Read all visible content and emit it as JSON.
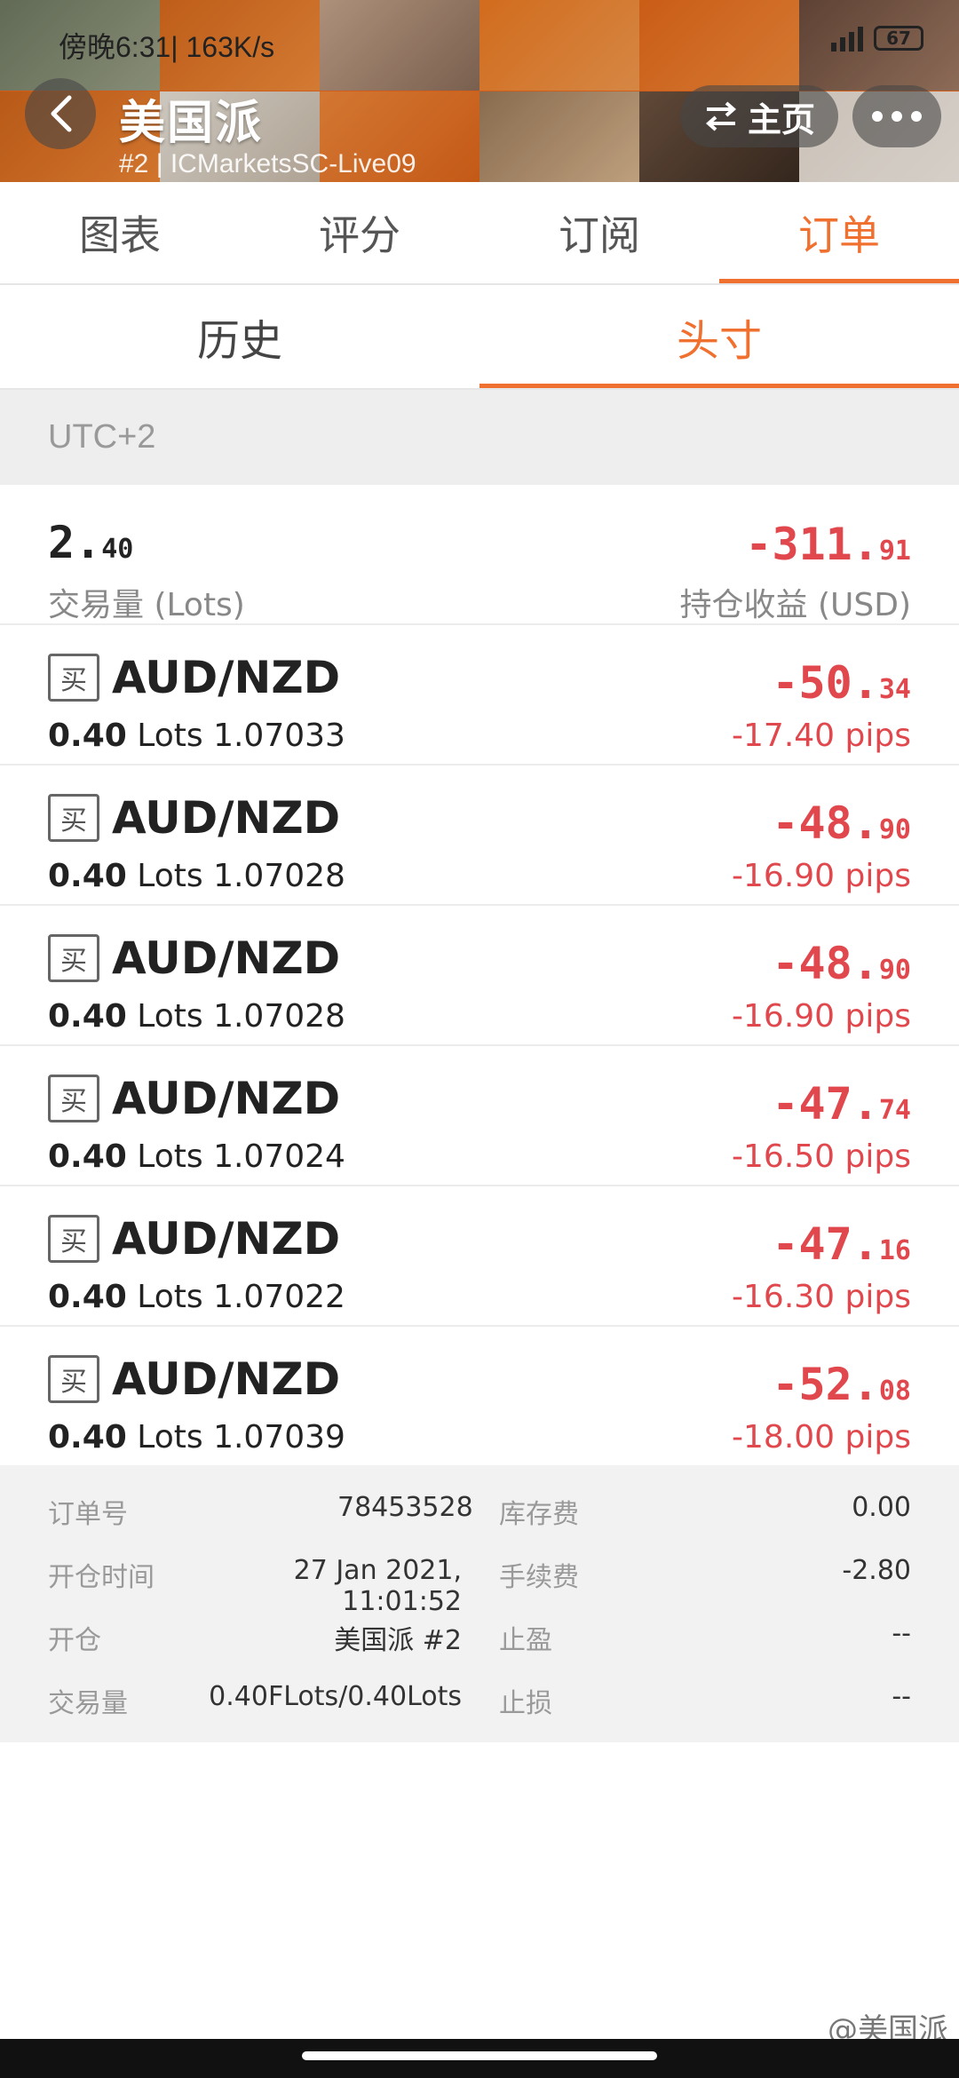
{
  "status_bar": {
    "time": "傍晚6:31",
    "speed": "163K/s",
    "battery": "67"
  },
  "header": {
    "title": "美国派",
    "subtitle": "#2 | ICMarketsSC-Live09",
    "home_label": "主页"
  },
  "main_tabs": [
    {
      "label": "图表",
      "active": false
    },
    {
      "label": "评分",
      "active": false
    },
    {
      "label": "订阅",
      "active": false
    },
    {
      "label": "订单",
      "active": true
    }
  ],
  "sub_tabs": [
    {
      "label": "历史",
      "active": false
    },
    {
      "label": "头寸",
      "active": true
    }
  ],
  "timezone": "UTC+2",
  "summary": {
    "volume_int": "2.",
    "volume_dec": "40",
    "volume_label": "交易量 (Lots)",
    "profit_int": "-311.",
    "profit_dec": "91",
    "profit_label": "持仓收益 (USD)"
  },
  "positions": [
    {
      "side": "买",
      "symbol": "AUD/NZD",
      "lots": "0.40",
      "lots_unit": "Lots",
      "price": "1.07033",
      "profit_int": "-50.",
      "profit_dec": "34",
      "pips": "-17.40 pips"
    },
    {
      "side": "买",
      "symbol": "AUD/NZD",
      "lots": "0.40",
      "lots_unit": "Lots",
      "price": "1.07028",
      "profit_int": "-48.",
      "profit_dec": "90",
      "pips": "-16.90 pips"
    },
    {
      "side": "买",
      "symbol": "AUD/NZD",
      "lots": "0.40",
      "lots_unit": "Lots",
      "price": "1.07028",
      "profit_int": "-48.",
      "profit_dec": "90",
      "pips": "-16.90 pips"
    },
    {
      "side": "买",
      "symbol": "AUD/NZD",
      "lots": "0.40",
      "lots_unit": "Lots",
      "price": "1.07024",
      "profit_int": "-47.",
      "profit_dec": "74",
      "pips": "-16.50 pips"
    },
    {
      "side": "买",
      "symbol": "AUD/NZD",
      "lots": "0.40",
      "lots_unit": "Lots",
      "price": "1.07022",
      "profit_int": "-47.",
      "profit_dec": "16",
      "pips": "-16.30 pips"
    },
    {
      "side": "买",
      "symbol": "AUD/NZD",
      "lots": "0.40",
      "lots_unit": "Lots",
      "price": "1.07039",
      "profit_int": "-52.",
      "profit_dec": "08",
      "pips": "-18.00 pips"
    }
  ],
  "detail": {
    "order_no_label": "订单号",
    "order_no": "78453528",
    "swap_label": "库存费",
    "swap": "0.00",
    "open_time_label": "开仓时间",
    "open_time": "27 Jan 2021, 11:01:52",
    "commission_label": "手续费",
    "commission": "-2.80",
    "open_label": "开仓",
    "open_by": "美国派 #2",
    "tp_label": "止盈",
    "tp": "--",
    "volume_label": "交易量",
    "volume": "0.40FLots/0.40Lots",
    "sl_label": "止损",
    "sl": "--"
  },
  "watermark": "@美国派",
  "colors": {
    "accent": "#f07030",
    "loss": "#e0484d"
  }
}
